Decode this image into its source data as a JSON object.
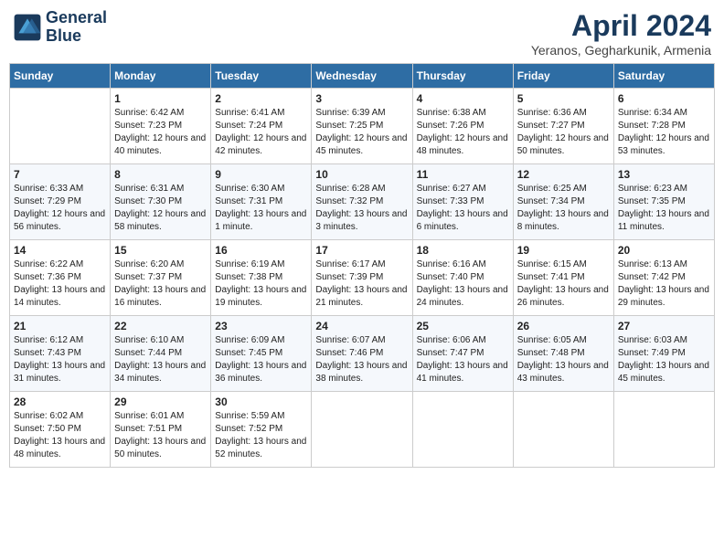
{
  "header": {
    "logo_line1": "General",
    "logo_line2": "Blue",
    "month": "April 2024",
    "location": "Yeranos, Gegharkunik, Armenia"
  },
  "weekdays": [
    "Sunday",
    "Monday",
    "Tuesday",
    "Wednesday",
    "Thursday",
    "Friday",
    "Saturday"
  ],
  "weeks": [
    [
      {
        "day": "",
        "sunrise": "",
        "sunset": "",
        "daylight": ""
      },
      {
        "day": "1",
        "sunrise": "Sunrise: 6:42 AM",
        "sunset": "Sunset: 7:23 PM",
        "daylight": "Daylight: 12 hours and 40 minutes."
      },
      {
        "day": "2",
        "sunrise": "Sunrise: 6:41 AM",
        "sunset": "Sunset: 7:24 PM",
        "daylight": "Daylight: 12 hours and 42 minutes."
      },
      {
        "day": "3",
        "sunrise": "Sunrise: 6:39 AM",
        "sunset": "Sunset: 7:25 PM",
        "daylight": "Daylight: 12 hours and 45 minutes."
      },
      {
        "day": "4",
        "sunrise": "Sunrise: 6:38 AM",
        "sunset": "Sunset: 7:26 PM",
        "daylight": "Daylight: 12 hours and 48 minutes."
      },
      {
        "day": "5",
        "sunrise": "Sunrise: 6:36 AM",
        "sunset": "Sunset: 7:27 PM",
        "daylight": "Daylight: 12 hours and 50 minutes."
      },
      {
        "day": "6",
        "sunrise": "Sunrise: 6:34 AM",
        "sunset": "Sunset: 7:28 PM",
        "daylight": "Daylight: 12 hours and 53 minutes."
      }
    ],
    [
      {
        "day": "7",
        "sunrise": "Sunrise: 6:33 AM",
        "sunset": "Sunset: 7:29 PM",
        "daylight": "Daylight: 12 hours and 56 minutes."
      },
      {
        "day": "8",
        "sunrise": "Sunrise: 6:31 AM",
        "sunset": "Sunset: 7:30 PM",
        "daylight": "Daylight: 12 hours and 58 minutes."
      },
      {
        "day": "9",
        "sunrise": "Sunrise: 6:30 AM",
        "sunset": "Sunset: 7:31 PM",
        "daylight": "Daylight: 13 hours and 1 minute."
      },
      {
        "day": "10",
        "sunrise": "Sunrise: 6:28 AM",
        "sunset": "Sunset: 7:32 PM",
        "daylight": "Daylight: 13 hours and 3 minutes."
      },
      {
        "day": "11",
        "sunrise": "Sunrise: 6:27 AM",
        "sunset": "Sunset: 7:33 PM",
        "daylight": "Daylight: 13 hours and 6 minutes."
      },
      {
        "day": "12",
        "sunrise": "Sunrise: 6:25 AM",
        "sunset": "Sunset: 7:34 PM",
        "daylight": "Daylight: 13 hours and 8 minutes."
      },
      {
        "day": "13",
        "sunrise": "Sunrise: 6:23 AM",
        "sunset": "Sunset: 7:35 PM",
        "daylight": "Daylight: 13 hours and 11 minutes."
      }
    ],
    [
      {
        "day": "14",
        "sunrise": "Sunrise: 6:22 AM",
        "sunset": "Sunset: 7:36 PM",
        "daylight": "Daylight: 13 hours and 14 minutes."
      },
      {
        "day": "15",
        "sunrise": "Sunrise: 6:20 AM",
        "sunset": "Sunset: 7:37 PM",
        "daylight": "Daylight: 13 hours and 16 minutes."
      },
      {
        "day": "16",
        "sunrise": "Sunrise: 6:19 AM",
        "sunset": "Sunset: 7:38 PM",
        "daylight": "Daylight: 13 hours and 19 minutes."
      },
      {
        "day": "17",
        "sunrise": "Sunrise: 6:17 AM",
        "sunset": "Sunset: 7:39 PM",
        "daylight": "Daylight: 13 hours and 21 minutes."
      },
      {
        "day": "18",
        "sunrise": "Sunrise: 6:16 AM",
        "sunset": "Sunset: 7:40 PM",
        "daylight": "Daylight: 13 hours and 24 minutes."
      },
      {
        "day": "19",
        "sunrise": "Sunrise: 6:15 AM",
        "sunset": "Sunset: 7:41 PM",
        "daylight": "Daylight: 13 hours and 26 minutes."
      },
      {
        "day": "20",
        "sunrise": "Sunrise: 6:13 AM",
        "sunset": "Sunset: 7:42 PM",
        "daylight": "Daylight: 13 hours and 29 minutes."
      }
    ],
    [
      {
        "day": "21",
        "sunrise": "Sunrise: 6:12 AM",
        "sunset": "Sunset: 7:43 PM",
        "daylight": "Daylight: 13 hours and 31 minutes."
      },
      {
        "day": "22",
        "sunrise": "Sunrise: 6:10 AM",
        "sunset": "Sunset: 7:44 PM",
        "daylight": "Daylight: 13 hours and 34 minutes."
      },
      {
        "day": "23",
        "sunrise": "Sunrise: 6:09 AM",
        "sunset": "Sunset: 7:45 PM",
        "daylight": "Daylight: 13 hours and 36 minutes."
      },
      {
        "day": "24",
        "sunrise": "Sunrise: 6:07 AM",
        "sunset": "Sunset: 7:46 PM",
        "daylight": "Daylight: 13 hours and 38 minutes."
      },
      {
        "day": "25",
        "sunrise": "Sunrise: 6:06 AM",
        "sunset": "Sunset: 7:47 PM",
        "daylight": "Daylight: 13 hours and 41 minutes."
      },
      {
        "day": "26",
        "sunrise": "Sunrise: 6:05 AM",
        "sunset": "Sunset: 7:48 PM",
        "daylight": "Daylight: 13 hours and 43 minutes."
      },
      {
        "day": "27",
        "sunrise": "Sunrise: 6:03 AM",
        "sunset": "Sunset: 7:49 PM",
        "daylight": "Daylight: 13 hours and 45 minutes."
      }
    ],
    [
      {
        "day": "28",
        "sunrise": "Sunrise: 6:02 AM",
        "sunset": "Sunset: 7:50 PM",
        "daylight": "Daylight: 13 hours and 48 minutes."
      },
      {
        "day": "29",
        "sunrise": "Sunrise: 6:01 AM",
        "sunset": "Sunset: 7:51 PM",
        "daylight": "Daylight: 13 hours and 50 minutes."
      },
      {
        "day": "30",
        "sunrise": "Sunrise: 5:59 AM",
        "sunset": "Sunset: 7:52 PM",
        "daylight": "Daylight: 13 hours and 52 minutes."
      },
      {
        "day": "",
        "sunrise": "",
        "sunset": "",
        "daylight": ""
      },
      {
        "day": "",
        "sunrise": "",
        "sunset": "",
        "daylight": ""
      },
      {
        "day": "",
        "sunrise": "",
        "sunset": "",
        "daylight": ""
      },
      {
        "day": "",
        "sunrise": "",
        "sunset": "",
        "daylight": ""
      }
    ]
  ]
}
